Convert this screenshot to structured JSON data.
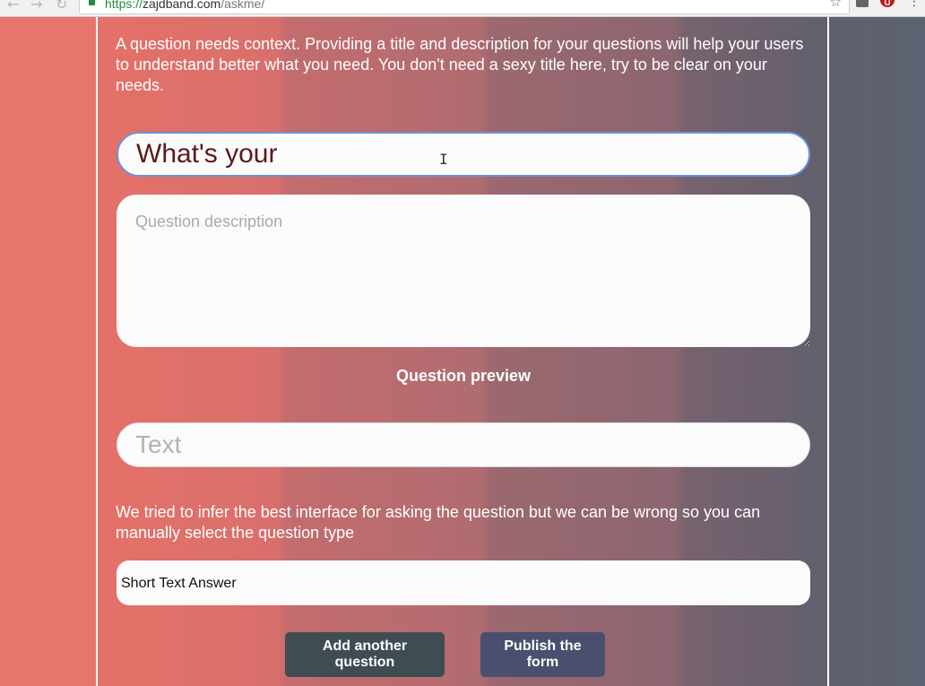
{
  "browser": {
    "back_glyph": "←",
    "forward_glyph": "→",
    "reload_glyph": "↻",
    "url_scheme": "https://",
    "url_host": "zajdband.com",
    "url_path": "/askme/",
    "bookmark_glyph": "☆",
    "menu_glyph": "⋮",
    "ublock_letter": "U",
    "icons": [
      "back-arrow-icon",
      "forward-arrow-icon",
      "reload-icon",
      "lock-icon",
      "bookmark-star-icon",
      "mail-extension-icon",
      "ublock-extension-icon",
      "menu-dots-icon"
    ]
  },
  "form": {
    "intro_text": "A question needs context. Providing a title and description for your questions will help your users to understand better what you need. You don't need a sexy title here, try to be clear on your needs.",
    "title_value": "What's your",
    "description_value": "",
    "description_placeholder": "Question description",
    "preview_heading": "Question preview",
    "preview_value": "",
    "preview_placeholder": "Text",
    "infer_note": "We tried to infer the best interface for asking the question but we can be wrong so you can manually select the question type",
    "question_type_selected": "Short Text Answer",
    "add_button": "Add another question",
    "publish_button": "Publish the form"
  },
  "colors": {
    "bg_left": "#e8756b",
    "bg_right": "#5b6271",
    "add_button": "#3f4d53",
    "publish_button": "#4a4f6e",
    "focus_border": "#6a92dd",
    "title_text": "#5a1a1a"
  }
}
